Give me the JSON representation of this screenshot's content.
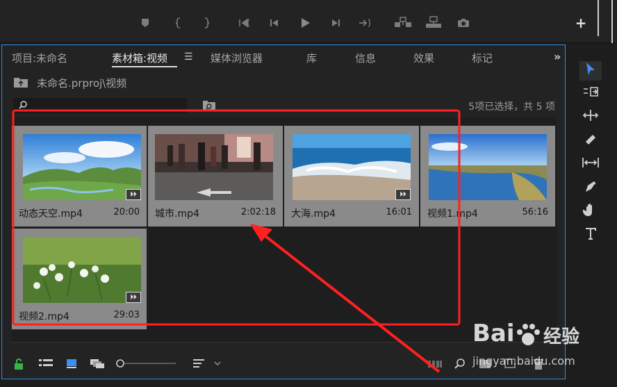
{
  "transport": {
    "icons": [
      "marker-icon",
      "mark-in-icon",
      "mark-out-icon",
      "go-to-in-icon",
      "step-back-icon",
      "play-icon",
      "step-forward-icon",
      "go-to-out-icon",
      "insert-icon",
      "overwrite-icon",
      "camera-icon"
    ],
    "add_label": "+"
  },
  "tabs": [
    {
      "label": "项目:未命名"
    },
    {
      "label": "素材箱:视频"
    },
    {
      "label": "媒体浏览器"
    },
    {
      "label": "库"
    },
    {
      "label": "信息"
    },
    {
      "label": "效果"
    },
    {
      "label": "标记"
    }
  ],
  "active_tab": "素材箱:视频",
  "path": {
    "text": "未命名.prproj\\视频"
  },
  "search": {
    "value": "",
    "placeholder": ""
  },
  "selection_status": "5项已选择，共 5 项",
  "clips": [
    {
      "name": "动态天空.mp4",
      "duration": "20:00",
      "scene": "sky",
      "has_audio_badge": true
    },
    {
      "name": "城市.mp4",
      "duration": "2:02:18",
      "scene": "city",
      "has_audio_badge": false
    },
    {
      "name": "大海.mp4",
      "duration": "16:01",
      "scene": "sea",
      "has_audio_badge": true
    },
    {
      "name": "视频1.mp4",
      "duration": "56:16",
      "scene": "river",
      "has_audio_badge": false
    },
    {
      "name": "视频2.mp4",
      "duration": "29:03",
      "scene": "flowers",
      "has_audio_badge": true
    }
  ],
  "badge_glyph": "⏵⏵",
  "colors": {
    "panel_border": "#2d8ceb",
    "tile_bg": "#8a8a8a",
    "annotation_red": "#ff2020",
    "tool_accent": "#3d8ef0"
  },
  "tools": [
    "selection-tool-icon",
    "track-select-icon",
    "ripple-edit-icon",
    "razor-icon",
    "slip-icon",
    "pen-icon",
    "hand-icon",
    "type-icon"
  ],
  "watermark": {
    "brand": "Bai",
    "brand_suffix": "经验",
    "url": "jingyan.baidu.com"
  }
}
